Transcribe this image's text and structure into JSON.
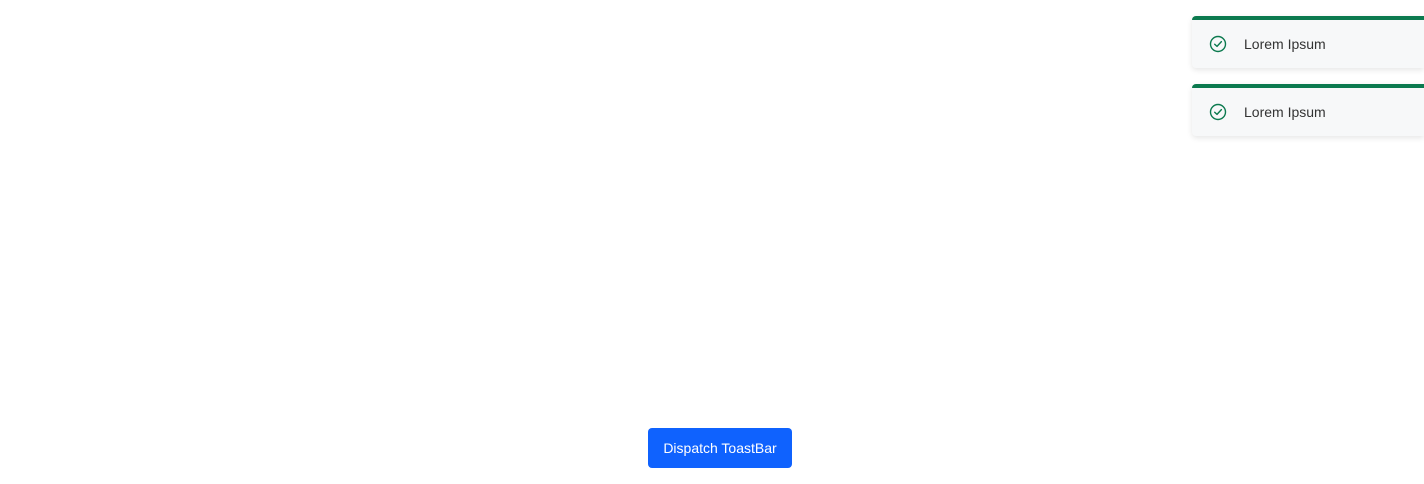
{
  "colors": {
    "accent": "#0c7a4f",
    "button": "#0f62fe",
    "toast_bg": "#f7f8f9",
    "text": "#333333"
  },
  "toasts": [
    {
      "message": "Lorem Ipsum",
      "icon": "check-circle-icon",
      "status": "success"
    },
    {
      "message": "Lorem Ipsum",
      "icon": "check-circle-icon",
      "status": "success"
    }
  ],
  "main": {
    "dispatch_label": "Dispatch ToastBar"
  }
}
